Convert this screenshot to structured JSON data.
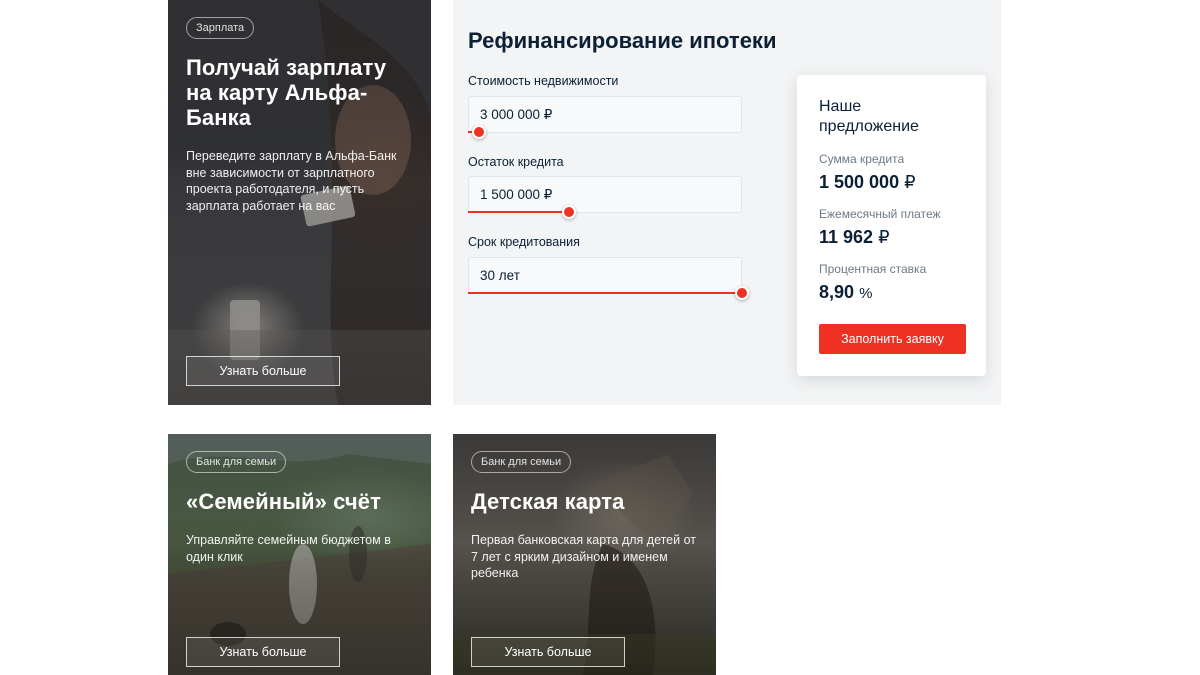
{
  "salary_card": {
    "chip": "Зарплата",
    "title": "Получай зарплату на карту Альфа-Банка",
    "text": "Переведите зарплату в Альфа-Банк вне зависимости от зарплатного проекта работодателя, и пусть зарплата работает на вас",
    "button": "Узнать больше"
  },
  "refinance": {
    "title": "Рефинансирование ипотеки",
    "fields": [
      {
        "label": "Стоимость недвижимости",
        "value": "3 000 000 ₽",
        "slider": 0.04
      },
      {
        "label": "Остаток кредита",
        "value": "1 500 000 ₽",
        "slider": 0.37
      },
      {
        "label": "Срок кредитования",
        "value": "30 лет",
        "slider": 1.0
      }
    ],
    "offer": {
      "title": "Наше предложение",
      "amount_label": "Сумма кредита",
      "amount_value": "1 500 000",
      "amount_currency": "₽",
      "payment_label": "Ежемесячный платеж",
      "payment_value": "11 962",
      "payment_currency": "₽",
      "rate_label": "Процентная ставка",
      "rate_value": "8,90",
      "rate_unit": "%",
      "button": "Заполнить заявку"
    }
  },
  "family_card": {
    "chip": "Банк для семьи",
    "title": "«Семейный» счёт",
    "text": "Управляйте семейным бюджетом в один клик",
    "button": "Узнать больше"
  },
  "kids_card": {
    "chip": "Банк для семьи",
    "title": "Детская карта",
    "text": "Первая банковская карта для детей от 7 лет с ярким дизайном и именем ребенка",
    "button": "Узнать больше"
  },
  "colors": {
    "accent": "#ef3124",
    "text": "#0b1f35",
    "panel": "#f3f4f5"
  }
}
